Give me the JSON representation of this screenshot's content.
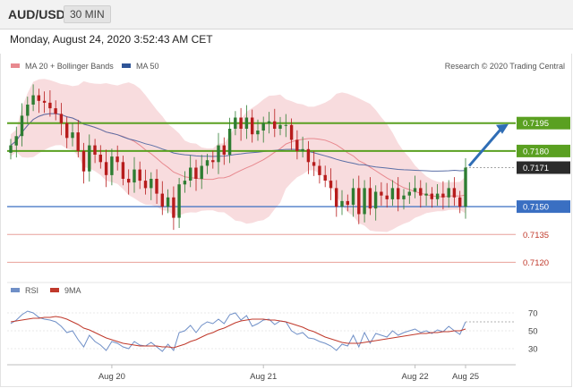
{
  "header": {
    "symbol": "AUD/USD",
    "interval": "30 MIN"
  },
  "datetime": "Monday, August 24, 2020 3:52:43 AM CET",
  "credit": "Research © 2020 Trading Central",
  "colors": {
    "bullish": "#2e7d32",
    "bearish": "#b71c1c",
    "bollinger": "#f5c9cc",
    "ma20": "#e8898f",
    "ma50": "#5b6fa6",
    "resistance": "#5aa021",
    "support": "#3a6fc2",
    "support_minor": "#e8a09a",
    "arrow": "#2f6db5",
    "rsi": "#6f8fc7",
    "rsi_ma": "#c0392b"
  },
  "chart_data": [
    {
      "type": "candlestick",
      "title": "AUD/USD",
      "interval": "30 MIN",
      "legend": [
        {
          "name": "MA 20 + Bollinger Bands",
          "color": "#e8898f"
        },
        {
          "name": "MA 50",
          "color": "#2f5597"
        }
      ],
      "x_ticks": [
        "Aug 20",
        "Aug 21",
        "Aug 22",
        "Aug 25"
      ],
      "ylim": [
        0.7112,
        0.7218
      ],
      "levels": [
        {
          "value": 0.7195,
          "label": "0.7195",
          "kind": "resistance"
        },
        {
          "value": 0.718,
          "label": "0.7180",
          "kind": "resistance"
        },
        {
          "value": 0.7171,
          "label": "0.7171",
          "kind": "last"
        },
        {
          "value": 0.715,
          "label": "0.7150",
          "kind": "support"
        },
        {
          "value": 0.7135,
          "label": "0.7135",
          "kind": "support-minor"
        },
        {
          "value": 0.712,
          "label": "0.7120",
          "kind": "support-minor"
        }
      ],
      "close": [
        0.7183,
        0.7188,
        0.7199,
        0.7205,
        0.721,
        0.7207,
        0.7206,
        0.7203,
        0.72,
        0.7195,
        0.7187,
        0.719,
        0.718,
        0.7169,
        0.7183,
        0.7178,
        0.7174,
        0.7167,
        0.7177,
        0.7174,
        0.7165,
        0.7163,
        0.717,
        0.7164,
        0.716,
        0.7165,
        0.7157,
        0.715,
        0.7155,
        0.7144,
        0.7162,
        0.7164,
        0.7171,
        0.7165,
        0.7172,
        0.7175,
        0.7174,
        0.7183,
        0.7178,
        0.7192,
        0.7198,
        0.7192,
        0.7198,
        0.7189,
        0.7191,
        0.7195,
        0.7196,
        0.7192,
        0.7194,
        0.7194,
        0.7186,
        0.718,
        0.7181,
        0.7174,
        0.7172,
        0.7167,
        0.7164,
        0.716,
        0.715,
        0.7153,
        0.7151,
        0.716,
        0.7146,
        0.716,
        0.7149,
        0.7158,
        0.7156,
        0.7154,
        0.716,
        0.7154,
        0.7156,
        0.7158,
        0.716,
        0.7156,
        0.7157,
        0.7154,
        0.7157,
        0.7155,
        0.716,
        0.7155,
        0.715,
        0.7171
      ]
    },
    {
      "type": "line",
      "title": "RSI",
      "legend": [
        {
          "name": "RSI",
          "color": "#6f8fc7"
        },
        {
          "name": "9MA",
          "color": "#c0392b"
        }
      ],
      "y_ticks": [
        70,
        50,
        30
      ],
      "ylim": [
        15,
        80
      ],
      "series": [
        {
          "name": "RSI",
          "values": [
            58,
            62,
            68,
            72,
            70,
            65,
            63,
            62,
            60,
            55,
            48,
            50,
            40,
            32,
            45,
            38,
            34,
            28,
            38,
            36,
            32,
            30,
            38,
            34,
            33,
            37,
            32,
            27,
            35,
            28,
            48,
            50,
            56,
            48,
            56,
            60,
            58,
            63,
            58,
            68,
            70,
            62,
            67,
            55,
            58,
            62,
            63,
            57,
            61,
            60,
            50,
            46,
            48,
            42,
            41,
            38,
            36,
            33,
            28,
            35,
            33,
            45,
            32,
            48,
            36,
            47,
            45,
            43,
            50,
            45,
            48,
            50,
            52,
            48,
            50,
            47,
            51,
            49,
            55,
            50,
            46,
            60
          ]
        },
        {
          "name": "9MA",
          "values": [
            60,
            61,
            62,
            63,
            64,
            64,
            65,
            65,
            66,
            65,
            63,
            60,
            57,
            53,
            51,
            48,
            45,
            42,
            40,
            38,
            36,
            35,
            34,
            33,
            33,
            33,
            33,
            32,
            32,
            31,
            33,
            35,
            38,
            40,
            43,
            46,
            48,
            51,
            53,
            56,
            59,
            61,
            62,
            63,
            63,
            63,
            62,
            62,
            61,
            60,
            58,
            56,
            54,
            51,
            49,
            46,
            43,
            41,
            39,
            37,
            36,
            36,
            36,
            37,
            38,
            39,
            40,
            41,
            42,
            43,
            44,
            45,
            46,
            47,
            47,
            48,
            48,
            49,
            49,
            50,
            50,
            52
          ]
        }
      ]
    }
  ]
}
